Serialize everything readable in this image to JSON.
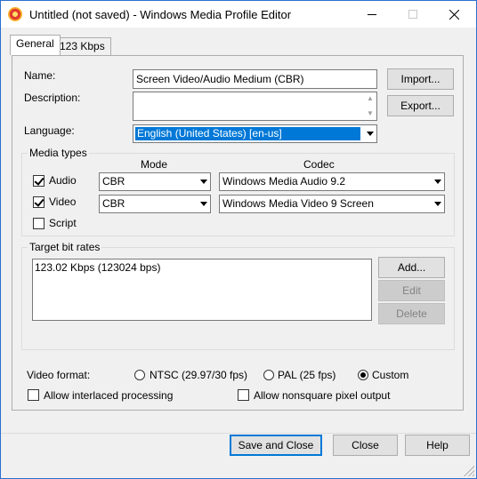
{
  "window": {
    "title": "Untitled (not saved) - Windows Media Profile Editor",
    "icon": "wmp-app-icon"
  },
  "tabs": [
    {
      "label": "General",
      "active": true
    },
    {
      "label": "123 Kbps",
      "active": false
    }
  ],
  "general": {
    "name_label": "Name:",
    "name_value": "Screen Video/Audio Medium (CBR)",
    "description_label": "Description:",
    "description_value": "",
    "language_label": "Language:",
    "language_value": "English (United States) [en-us]",
    "import_button": "Import...",
    "export_button": "Export..."
  },
  "media_types": {
    "title": "Media types",
    "mode_header": "Mode",
    "codec_header": "Codec",
    "audio": {
      "label": "Audio",
      "checked": true,
      "mode": "CBR",
      "codec": "Windows Media Audio 9.2"
    },
    "video": {
      "label": "Video",
      "checked": true,
      "mode": "CBR",
      "codec": "Windows Media Video 9 Screen"
    },
    "script": {
      "label": "Script",
      "checked": false
    }
  },
  "bit_rates": {
    "title": "Target bit rates",
    "items": [
      "123.02 Kbps (123024 bps)"
    ],
    "add_button": "Add...",
    "edit_button": "Edit",
    "delete_button": "Delete"
  },
  "video_format": {
    "label": "Video format:",
    "options": [
      {
        "label": "NTSC (29.97/30 fps)",
        "selected": false
      },
      {
        "label": "PAL (25 fps)",
        "selected": false
      },
      {
        "label": "Custom",
        "selected": true
      }
    ],
    "interlaced_label": "Allow interlaced processing",
    "interlaced_checked": false,
    "nonsquare_label": "Allow nonsquare pixel output",
    "nonsquare_checked": false
  },
  "footer": {
    "save_close": "Save and Close",
    "close": "Close",
    "help": "Help"
  },
  "colors": {
    "accent": "#0078d7",
    "close_x": "#000000"
  }
}
